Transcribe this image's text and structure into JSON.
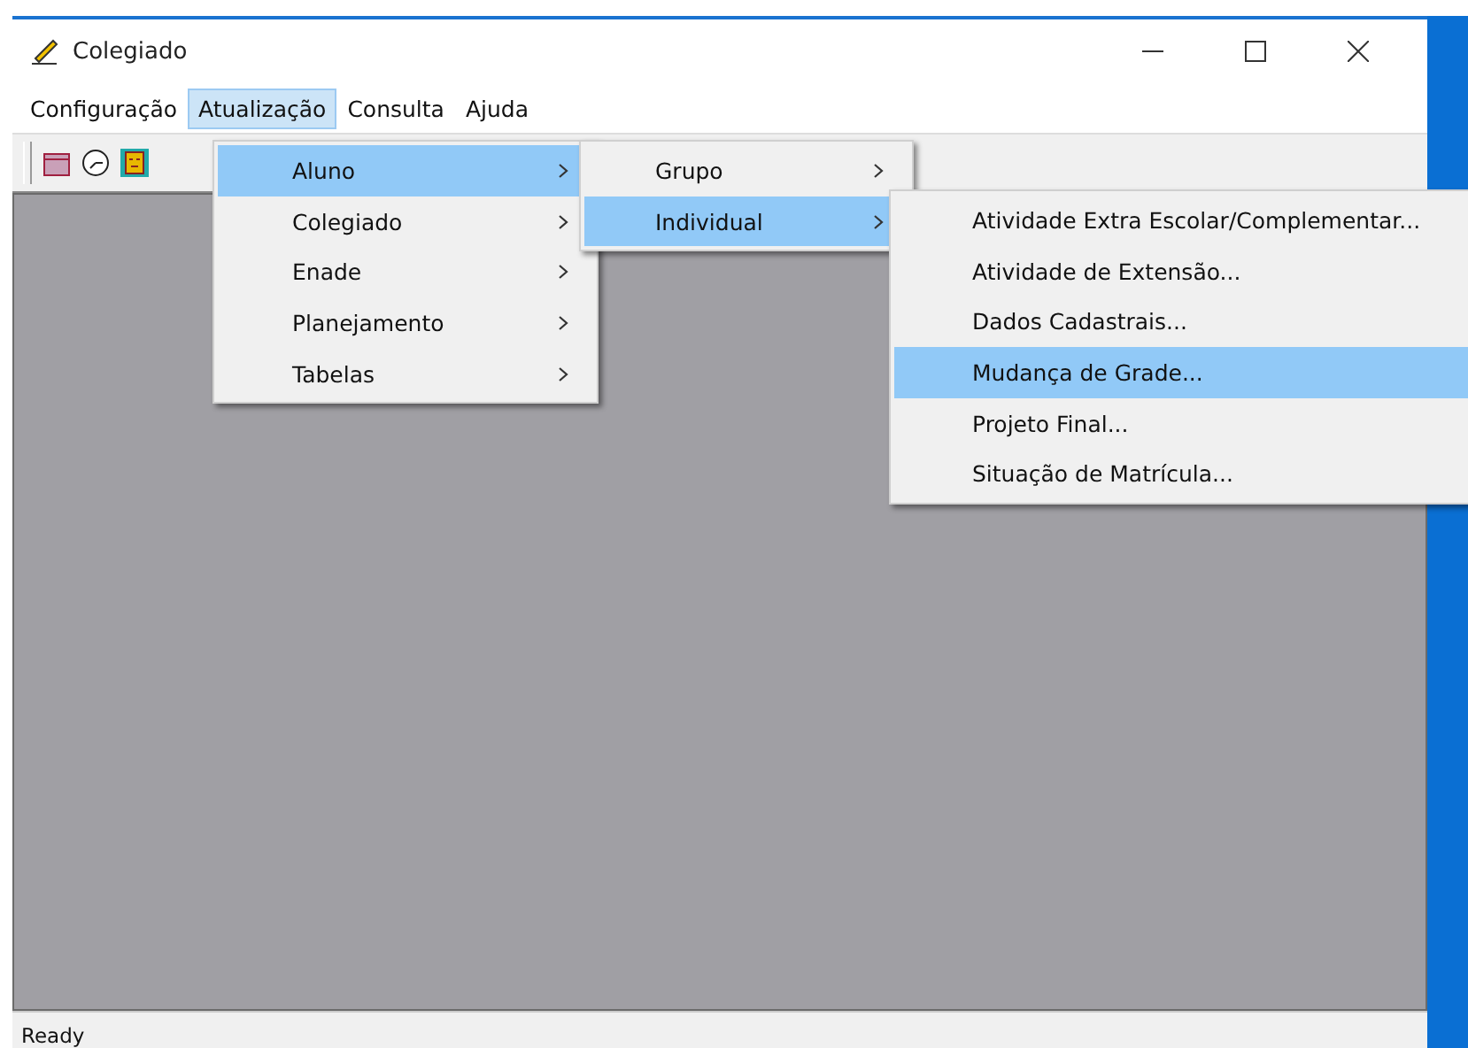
{
  "window": {
    "title": "Colegiado"
  },
  "menu_bar": [
    {
      "label": "Configuração",
      "selected": false
    },
    {
      "label": "Atualização",
      "selected": true
    },
    {
      "label": "Consulta",
      "selected": false
    },
    {
      "label": "Ajuda",
      "selected": false
    }
  ],
  "menus": [
    {
      "items": [
        {
          "label": "Aluno",
          "submenu": true,
          "selected": true
        },
        {
          "label": "Colegiado",
          "submenu": true,
          "selected": false
        },
        {
          "label": "Enade",
          "submenu": true,
          "selected": false
        },
        {
          "label": "Planejamento",
          "submenu": true,
          "selected": false
        },
        {
          "label": "Tabelas",
          "submenu": true,
          "selected": false
        }
      ]
    },
    {
      "items": [
        {
          "label": "Grupo",
          "submenu": true,
          "selected": false
        },
        {
          "label": "Individual",
          "submenu": true,
          "selected": true
        }
      ]
    },
    {
      "items": [
        {
          "label": "Atividade Extra Escolar/Complementar...",
          "submenu": false,
          "selected": false
        },
        {
          "label": "Atividade de Extensão...",
          "submenu": false,
          "selected": false
        },
        {
          "label": "Dados Cadastrais...",
          "submenu": false,
          "selected": false
        },
        {
          "label": "Mudança de Grade...",
          "submenu": false,
          "selected": true
        },
        {
          "label": "Projeto Final...",
          "submenu": false,
          "selected": false
        },
        {
          "label": "Situação de Matrícula...",
          "submenu": false,
          "selected": false
        }
      ]
    }
  ],
  "status_bar": {
    "text": "Ready"
  }
}
